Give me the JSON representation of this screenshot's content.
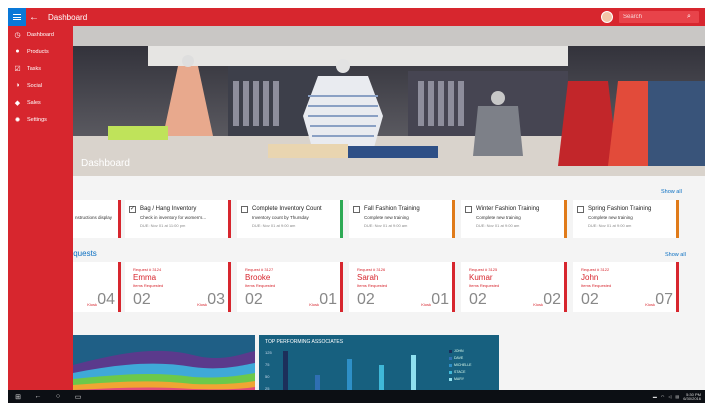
{
  "header": {
    "back_icon": "arrow-left-icon",
    "title": "Dashboard",
    "search_placeholder": "Search",
    "colors": {
      "accent": "#d7262e",
      "hamburger": "#0a78d7"
    }
  },
  "sidebar": {
    "items": [
      {
        "label": "Dashboard",
        "icon": "clock-icon"
      },
      {
        "label": "Products",
        "icon": "cart-icon"
      },
      {
        "label": "Tasks",
        "icon": "checkbox-icon"
      },
      {
        "label": "Social",
        "icon": "people-icon"
      },
      {
        "label": "Sales",
        "icon": "tag-icon"
      },
      {
        "label": "Settings",
        "icon": "gear-icon"
      }
    ]
  },
  "hero": {
    "title": "Dashboard"
  },
  "tasks": {
    "show_all": "Show all",
    "items": [
      {
        "title": "Bag / Hang Inventory",
        "desc": "Check in inventory for women's...",
        "when": "DUE: Nov 01 at 11:00 pm",
        "bar": "#d7262e",
        "checked": true
      },
      {
        "title": "Complete Inventory Count",
        "desc": "Inventory count by Thursday",
        "when": "DUE: Nov 01 at 9:00 am",
        "bar": "#2eaa55",
        "checked": false
      },
      {
        "title": "Fall Fashion Training",
        "desc": "Complete new training",
        "when": "DUE: Nov 01 at 9:00 am",
        "bar": "#e07b1a",
        "checked": false
      },
      {
        "title": "Winter Fashion Training",
        "desc": "Complete new training",
        "when": "DUE: Nov 01 at 9:00 am",
        "bar": "#e07b1a",
        "checked": false
      },
      {
        "title": "Spring Fashion Training",
        "desc": "Complete new training",
        "when": "DUE: Nov 01 at 9:00 am",
        "bar": "#e07b1a",
        "checked": false
      }
    ]
  },
  "requests": {
    "title": "Requests",
    "show_all": "Show all",
    "items_requested_label": "Items Requested",
    "kiosk_label": "Kiosk",
    "items": [
      {
        "num": "Request # 3124",
        "name": "Emma",
        "count": "02",
        "kiosk": "03"
      },
      {
        "num": "Request # 3127",
        "name": "Brooke",
        "count": "02",
        "kiosk": "01"
      },
      {
        "num": "Request # 3126",
        "name": "Sarah",
        "count": "02",
        "kiosk": "01"
      },
      {
        "num": "Request # 3125",
        "name": "Kumar",
        "count": "02",
        "kiosk": "02"
      },
      {
        "num": "Request # 3122",
        "name": "John",
        "count": "02",
        "kiosk": "07"
      }
    ],
    "first_partial_kiosk": "04"
  },
  "associates": {
    "title": "TOP PERFORMING ASSOCIATES",
    "yticks": [
      "125",
      "75",
      "50",
      "25"
    ],
    "legend": [
      {
        "label": "JOHN",
        "color": "#1c2f5a"
      },
      {
        "label": "DAVE",
        "color": "#2f6fb3"
      },
      {
        "label": "MICHELLE",
        "color": "#2e8fc7"
      },
      {
        "label": "STACE",
        "color": "#3fb8d8"
      },
      {
        "label": "MARY",
        "color": "#8fe0ef"
      }
    ]
  },
  "taskbar": {
    "time": "5:30 PM",
    "date": "6/30/2016"
  }
}
